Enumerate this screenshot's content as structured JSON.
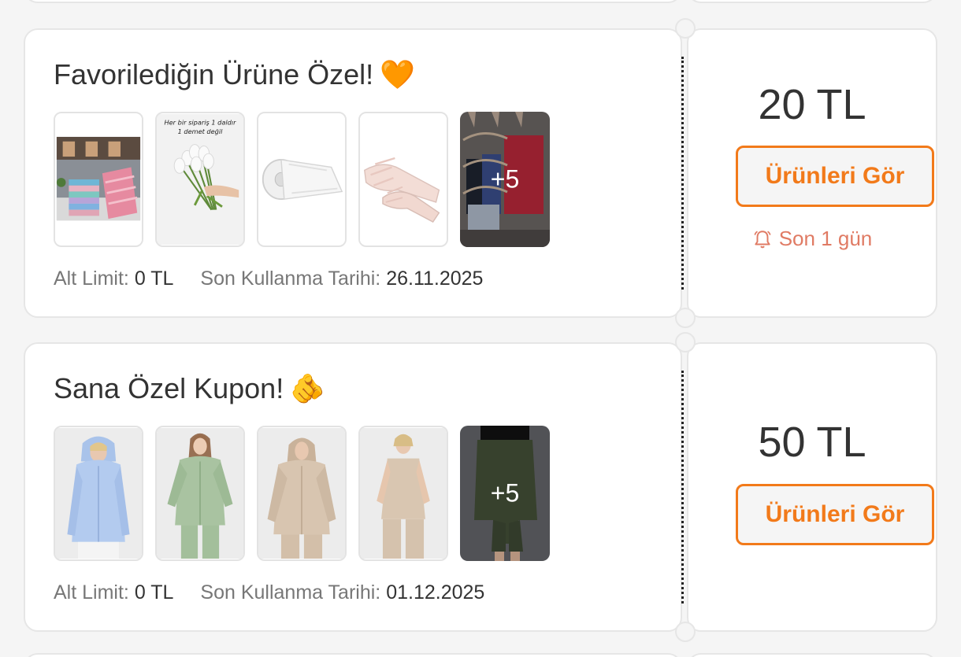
{
  "coupons": [
    {
      "title": "Favorilediğin Ürüne Özel!",
      "emoji": "🧡",
      "more_label": "+5",
      "min_limit_label": "Alt Limit:",
      "min_limit_value": "0 TL",
      "expiry_label": "Son Kullanma Tarihi:",
      "expiry_value": "26.11.2025",
      "amount": "20 TL",
      "button_label": "Ürünleri Gör",
      "deadline": "Son 1 gün",
      "thumb1_caption_line1": "Her bir sipariş 1 daldır",
      "thumb1_caption_line2": "1 demet değil"
    },
    {
      "title": "Sana Özel Kupon!",
      "emoji": "🫵",
      "more_label": "+5",
      "min_limit_label": "Alt Limit:",
      "min_limit_value": "0 TL",
      "expiry_label": "Son Kullanma Tarihi:",
      "expiry_value": "01.12.2025",
      "amount": "50 TL",
      "button_label": "Ürünleri Gör"
    }
  ],
  "colors": {
    "accent": "#f27a1a",
    "deadline": "#e07b64",
    "background": "#f5f5f5"
  },
  "icons": {
    "deadline": "alarm-bell-icon"
  }
}
